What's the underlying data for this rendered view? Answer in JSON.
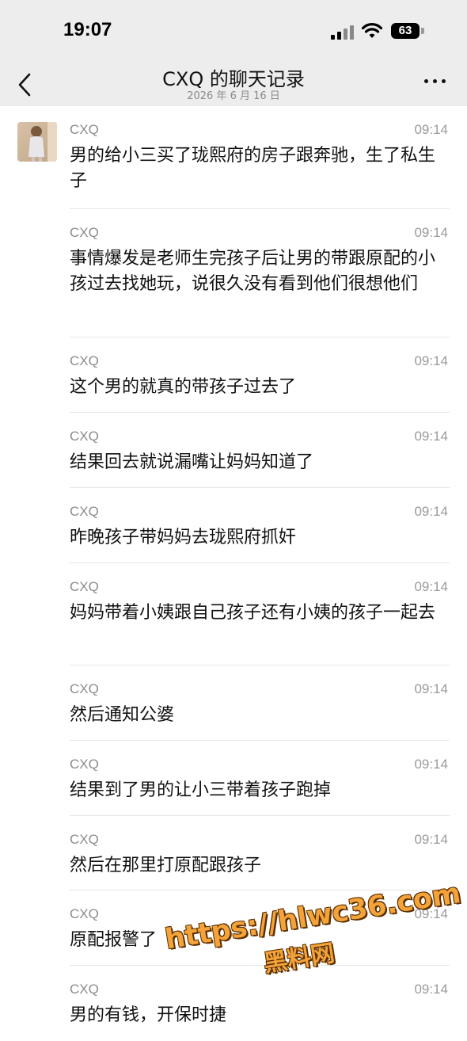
{
  "status_bar": {
    "time": "19:07",
    "battery": "63",
    "icons": [
      "signal-icon",
      "wifi-icon",
      "battery-icon"
    ]
  },
  "nav": {
    "title": "CXQ 的聊天记录",
    "subtitle": "2026 年 6 月 16 日",
    "icons": [
      "chevron-left-icon",
      "more-icon"
    ]
  },
  "messages": [
    {
      "sender": "CXQ",
      "time": "09:14",
      "text": "男的给小三买了珑熙府的房子跟奔驰，生了私生子"
    },
    {
      "sender": "CXQ",
      "time": "09:14",
      "text": "事情爆发是老师生完孩子后让男的带跟原配的小孩过去找她玩，说很久没有看到他们很想他们"
    },
    {
      "sender": "CXQ",
      "time": "09:14",
      "text": "这个男的就真的带孩子过去了"
    },
    {
      "sender": "CXQ",
      "time": "09:14",
      "text": "结果回去就说漏嘴让妈妈知道了"
    },
    {
      "sender": "CXQ",
      "time": "09:14",
      "text": "昨晚孩子带妈妈去珑熙府抓奸"
    },
    {
      "sender": "CXQ",
      "time": "09:14",
      "text": "妈妈带着小姨跟自己孩子还有小姨的孩子一起去"
    },
    {
      "sender": "CXQ",
      "time": "09:14",
      "text": "然后通知公婆"
    },
    {
      "sender": "CXQ",
      "time": "09:14",
      "text": "结果到了男的让小三带着孩子跑掉"
    },
    {
      "sender": "CXQ",
      "time": "09:14",
      "text": "然后在那里打原配跟孩子"
    },
    {
      "sender": "CXQ",
      "time": "09:14",
      "text": "原配报警了"
    },
    {
      "sender": "CXQ",
      "time": "09:14",
      "text": "男的有钱，开保时捷"
    }
  ],
  "watermark": {
    "url": "https://hlwc36.com",
    "name": "黑料网"
  },
  "colors": {
    "header_bg": "#ededed",
    "divider": "#e6e6e6",
    "meta_text": "#8c8c8c",
    "watermark": "#f4a33a"
  }
}
